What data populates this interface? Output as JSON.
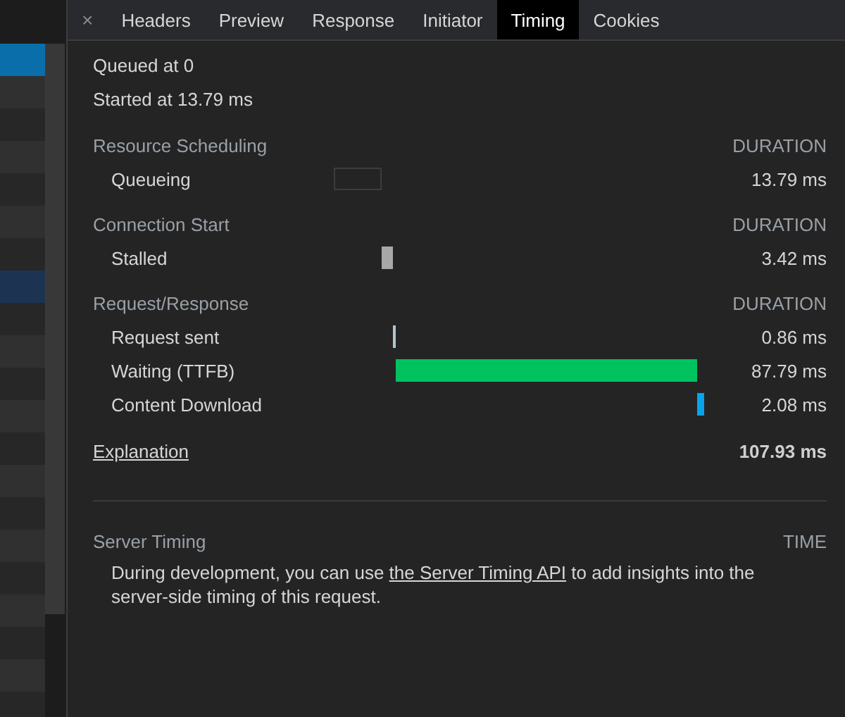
{
  "request_list": {
    "rows": [
      {
        "selected": true,
        "highlighted": false
      },
      {
        "selected": false,
        "highlighted": false
      },
      {
        "selected": false,
        "highlighted": false
      },
      {
        "selected": false,
        "highlighted": false
      },
      {
        "selected": false,
        "highlighted": false
      },
      {
        "selected": false,
        "highlighted": false
      },
      {
        "selected": false,
        "highlighted": false
      },
      {
        "selected": false,
        "highlighted": true
      },
      {
        "selected": false,
        "highlighted": false
      },
      {
        "selected": false,
        "highlighted": false
      },
      {
        "selected": false,
        "highlighted": false
      },
      {
        "selected": false,
        "highlighted": false
      },
      {
        "selected": false,
        "highlighted": false
      },
      {
        "selected": false,
        "highlighted": false
      },
      {
        "selected": false,
        "highlighted": false
      },
      {
        "selected": false,
        "highlighted": false
      },
      {
        "selected": false,
        "highlighted": false
      },
      {
        "selected": false,
        "highlighted": false
      },
      {
        "selected": false,
        "highlighted": false
      },
      {
        "selected": false,
        "highlighted": false
      },
      {
        "selected": false,
        "highlighted": false
      }
    ]
  },
  "close_glyph": "×",
  "tabs": [
    {
      "label": "Headers",
      "selected": false
    },
    {
      "label": "Preview",
      "selected": false
    },
    {
      "label": "Response",
      "selected": false
    },
    {
      "label": "Initiator",
      "selected": false
    },
    {
      "label": "Timing",
      "selected": true
    },
    {
      "label": "Cookies",
      "selected": false
    }
  ],
  "queued_at": "Queued at 0",
  "started_at": "Started at 13.79 ms",
  "sections": [
    {
      "title": "Resource Scheduling",
      "column": "DURATION",
      "phases": [
        {
          "label": "Queueing",
          "kind": "outline",
          "color": "#3c3c3c",
          "duration": "13.79 ms"
        }
      ]
    },
    {
      "title": "Connection Start",
      "column": "DURATION",
      "phases": [
        {
          "label": "Stalled",
          "kind": "fill",
          "color": "#a8a8a8",
          "duration": "3.42 ms"
        }
      ]
    },
    {
      "title": "Request/Response",
      "column": "DURATION",
      "phases": [
        {
          "label": "Request sent",
          "kind": "fill",
          "color": "#b0c4d0",
          "duration": "0.86 ms"
        },
        {
          "label": "Waiting (TTFB)",
          "kind": "fill",
          "color": "#00c35f",
          "duration": "87.79 ms"
        },
        {
          "label": "Content Download",
          "kind": "fill",
          "color": "#0aa3ea",
          "duration": "2.08 ms"
        }
      ]
    }
  ],
  "explanation": {
    "link": "Explanation",
    "total": "107.93 ms"
  },
  "server_timing": {
    "title": "Server Timing",
    "column": "TIME",
    "text_before": "During development, you can use ",
    "link": "the Server Timing API",
    "text_after": " to add insights into the server-side timing of this request."
  }
}
